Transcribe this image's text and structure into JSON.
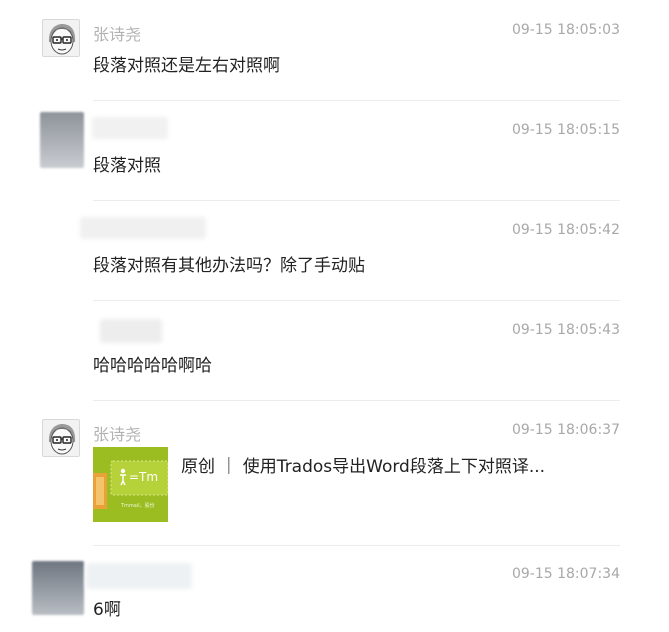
{
  "messages": [
    {
      "sender": "张诗尧",
      "time": "09-15 18:05:03",
      "text": "段落对照还是左右对照啊"
    },
    {
      "sender": "",
      "time": "09-15 18:05:15",
      "text": "段落对照"
    },
    {
      "sender": "",
      "time": "09-15 18:05:42",
      "text": "段落对照有其他办法吗？除了手动贴"
    },
    {
      "sender": "",
      "time": "09-15 18:05:43",
      "text": "哈哈哈哈哈啊哈"
    },
    {
      "sender": "张诗尧",
      "time": "09-15 18:06:37",
      "card": {
        "title": "原创 ｜ 使用Trados导出Word段落上下对照译...",
        "thumb_text": "=Tm",
        "thumb_caption": "Tmmail，股份"
      }
    },
    {
      "sender": "",
      "time": "09-15 18:07:34",
      "text": "6啊"
    }
  ],
  "colors": {
    "name": "#b2b2b2",
    "time": "#a8a8a8",
    "text": "#222222",
    "divider": "#ececec",
    "thumb_bg": "#9bbd22"
  }
}
